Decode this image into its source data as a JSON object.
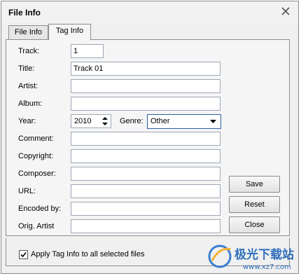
{
  "window": {
    "title": "File Info"
  },
  "tabs": [
    {
      "label": "File Info",
      "active": false
    },
    {
      "label": "Tag Info",
      "active": true
    }
  ],
  "fields": {
    "track": {
      "label": "Track:",
      "value": "1"
    },
    "title": {
      "label": "Title:",
      "value": "Track 01"
    },
    "artist": {
      "label": "Artist:",
      "value": ""
    },
    "album": {
      "label": "Album:",
      "value": ""
    },
    "year": {
      "label": "Year:",
      "value": "2010"
    },
    "genre": {
      "label": "Genre:",
      "value": "Other"
    },
    "comment": {
      "label": "Comment:",
      "value": ""
    },
    "copyright": {
      "label": "Copyright:",
      "value": ""
    },
    "composer": {
      "label": "Composer:",
      "value": ""
    },
    "url": {
      "label": "URL:",
      "value": ""
    },
    "encoded_by": {
      "label": "Encoded by:",
      "value": ""
    },
    "orig_artist": {
      "label": "Orig. Artist",
      "value": ""
    }
  },
  "buttons": {
    "save": "Save",
    "reset": "Reset",
    "close": "Close"
  },
  "apply_all": {
    "label": "Apply Tag Info to all selected files",
    "checked": true
  },
  "watermark": {
    "text": "极光下载站",
    "url": "www.xz7.com"
  }
}
